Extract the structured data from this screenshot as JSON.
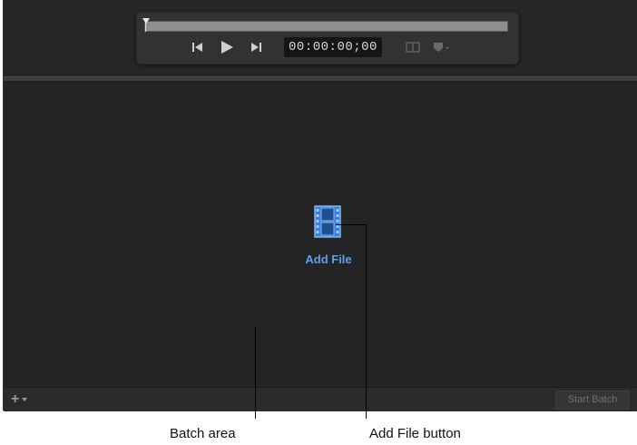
{
  "viewer": {
    "timecode": "00:00:00;00",
    "playhead_position": 0.0
  },
  "icons": {
    "previous": "skip-back-icon",
    "play": "play-icon",
    "next": "skip-forward-icon",
    "view": "viewer-layout-icon",
    "marker": "marker-icon",
    "add_file": "film-strip-icon",
    "add": "plus-icon"
  },
  "batch": {
    "add_file_label": "Add File",
    "add_menu_glyph": "+",
    "start_batch_label": "Start Batch"
  },
  "callouts": {
    "batch_area": "Batch area",
    "add_file_button": "Add File button"
  },
  "colors": {
    "accent": "#5aa2f0",
    "background": "#242424"
  }
}
